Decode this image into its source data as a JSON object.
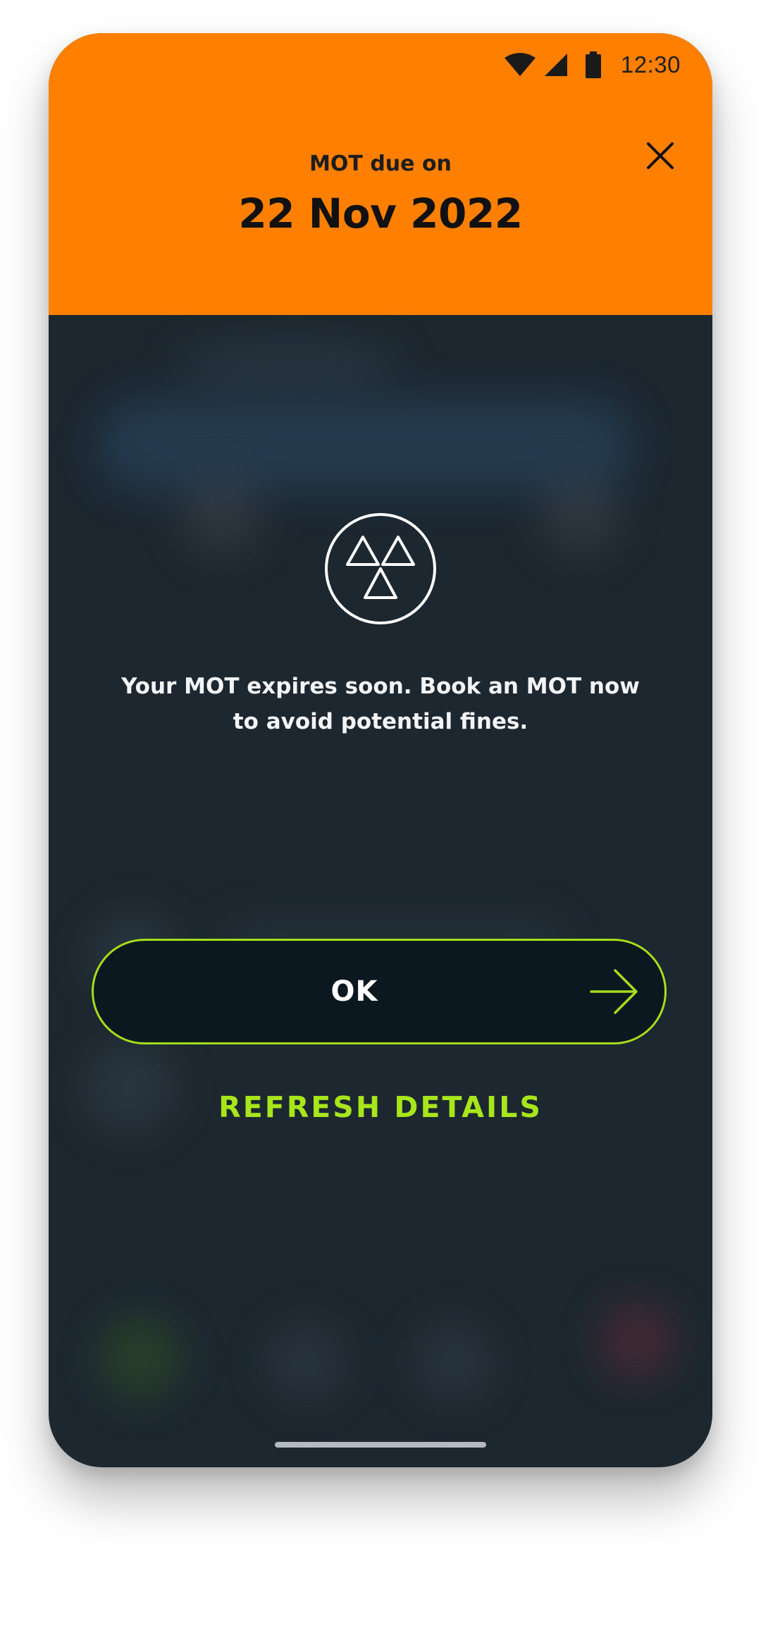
{
  "status_bar": {
    "time": "12:30",
    "wifi_icon": "wifi-icon",
    "signal_icon": "cellular-signal-icon",
    "battery_icon": "battery-icon"
  },
  "header": {
    "background_color": "#ff7f00",
    "due_label": "MOT due on",
    "due_date": "22 Nov 2022",
    "close_icon": "close-icon"
  },
  "body": {
    "icon": "mot-triangles-icon",
    "message": "Your MOT expires soon. Book an MOT now to avoid potential fines."
  },
  "actions": {
    "ok_label": "OK",
    "ok_icon": "arrow-right-icon",
    "accent_color": "#a6e61a",
    "refresh_label": "REFRESH DETAILS"
  }
}
